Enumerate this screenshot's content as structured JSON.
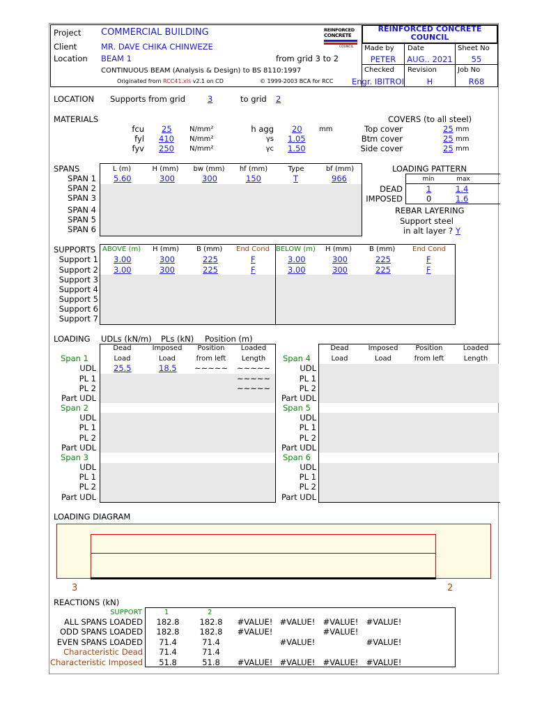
{
  "header": {
    "project_label": "Project",
    "project_value": "COMMERCIAL BUILDING",
    "client_label": "Client",
    "client_value": "MR. DAVE CHIKA CHINWEZE",
    "location_label": "Location",
    "location_value": "BEAM 1",
    "grid_text": "from grid 3 to 2",
    "description": "CONTINUOUS BEAM (Analysis & Design) to BS 8110:1997",
    "originated_prefix": "Originated from",
    "originated_file": "RCC41.xls",
    "originated_suffix": "v2.1 on CD",
    "copyright": "© 1999-2003 BCA for RCC",
    "logo_text": [
      "REINFORCED",
      "CONCRETE",
      "COUNCIL"
    ],
    "org_title": "REINFORCED CONCRETE COUNCIL",
    "made_by_label": "Made by",
    "made_by_value": "PETER",
    "date_label": "Date",
    "date_value": "AUG.. 2021",
    "sheet_label": "Sheet No",
    "sheet_value": "55",
    "checked_label": "Checked",
    "checked_value": "Engr. IBITROI",
    "revision_label": "Revision",
    "revision_value": "H",
    "job_label": "Job No",
    "job_value": "R68"
  },
  "location": {
    "label": "LOCATION",
    "supports_from": "Supports from grid",
    "from_value": "3",
    "to_label": "to grid",
    "to_value": "2"
  },
  "materials": {
    "label": "MATERIALS",
    "fcu_label": "fcu",
    "fcu_value": "25",
    "fcu_unit": "N/mm²",
    "fyl_label": "fyl",
    "fyl_value": "410",
    "fyl_unit": "N/mm²",
    "fyv_label": "fyv",
    "fyv_value": "250",
    "fyv_unit": "N/mm²",
    "hagg_label": "h agg",
    "hagg_value": "20",
    "hagg_unit": "mm",
    "ys_label": "γs",
    "ys_value": "1.05",
    "yc_label": "γc",
    "yc_value": "1.50"
  },
  "covers": {
    "title": "COVERS (to all steel)",
    "top_label": "Top cover",
    "top_value": "25",
    "btm_label": "Btm cover",
    "btm_value": "25",
    "side_label": "Side cover",
    "side_value": "25",
    "unit": "mm"
  },
  "spans": {
    "label": "SPANS",
    "headers": [
      "L (m)",
      "H (mm)",
      "bw (mm)",
      "hf (mm)",
      "Type",
      "bf (mm)"
    ],
    "rows": [
      "SPAN 1",
      "SPAN 2",
      "SPAN 3",
      "SPAN 4",
      "SPAN 5",
      "SPAN 6"
    ],
    "span1": [
      "5.60",
      "300",
      "300",
      "150",
      "T",
      "966"
    ]
  },
  "loading_pattern": {
    "title": "LOADING PATTERN",
    "min_label": "min",
    "max_label": "max",
    "dead_label": "DEAD",
    "dead_min": "1",
    "dead_max": "1.4",
    "imposed_label": "IMPOSED",
    "imposed_min": "0",
    "imposed_max": "1.6"
  },
  "rebar": {
    "title": "REBAR LAYERING",
    "line1": "Support steel",
    "line2": "in alt layer ?",
    "value": "Y"
  },
  "supports": {
    "label": "SUPPORTS",
    "above_label": "ABOVE (m)",
    "below_label": "BELOW (m)",
    "h_label": "H (mm)",
    "b_label": "B (mm)",
    "end_label": "End Cond",
    "rows": [
      "Support 1",
      "Support 2",
      "Support 3",
      "Support 4",
      "Support 5",
      "Support 6",
      "Support 7"
    ],
    "s1": [
      "3.00",
      "300",
      "225",
      "F",
      "3.00",
      "300",
      "225",
      "F"
    ],
    "s2": [
      "3.00",
      "300",
      "225",
      "F",
      "3.00",
      "300",
      "225",
      "F"
    ]
  },
  "loading": {
    "label": "LOADING",
    "udl_units": "UDLs (kN/m)",
    "pl_units": "PLs (kN)",
    "pos_units": "Position (m)",
    "col_dead": [
      "Dead",
      "Load"
    ],
    "col_imposed": [
      "Imposed",
      "Load"
    ],
    "col_position": [
      "Position",
      "from left"
    ],
    "col_loaded": [
      "Loaded",
      "Length"
    ],
    "span_labels": [
      "Span 1",
      "Span 2",
      "Span 3",
      "Span 4",
      "Span 5",
      "Span 6"
    ],
    "row_labels": [
      "UDL",
      "PL 1",
      "PL 2",
      "Part UDL"
    ],
    "span1_udl_dead": "25.5",
    "span1_udl_imposed": "18.5",
    "tilde": "~~~~~"
  },
  "diagram": {
    "label": "LOADING DIAGRAM",
    "left_grid": "3",
    "right_grid": "2",
    "colors": {
      "border": "#e00000",
      "fill": "#fdfbe3",
      "line": "#1a1ad6"
    }
  },
  "reactions": {
    "label": "REACTIONS (kN)",
    "support_label": "SUPPORT",
    "support_nums": [
      "1",
      "2"
    ],
    "rows": [
      {
        "label": "ALL SPANS LOADED",
        "v": [
          "182.8",
          "182.8",
          "#VALUE!",
          "#VALUE!",
          "#VALUE!",
          "#VALUE!"
        ]
      },
      {
        "label": "ODD SPANS LOADED",
        "v": [
          "182.8",
          "182.8",
          "#VALUE!",
          "",
          "#VALUE!",
          ""
        ]
      },
      {
        "label": "EVEN SPANS LOADED",
        "v": [
          "71.4",
          "71.4",
          "",
          "#VALUE!",
          "",
          "#VALUE!"
        ]
      },
      {
        "label": "Characteristic Dead",
        "v": [
          "71.4",
          "71.4",
          "",
          "",
          "",
          ""
        ]
      },
      {
        "label": "Characteristic Imposed",
        "v": [
          "51.8",
          "51.8",
          "#VALUE!",
          "#VALUE!",
          "#VALUE!",
          "#VALUE!"
        ]
      }
    ]
  }
}
